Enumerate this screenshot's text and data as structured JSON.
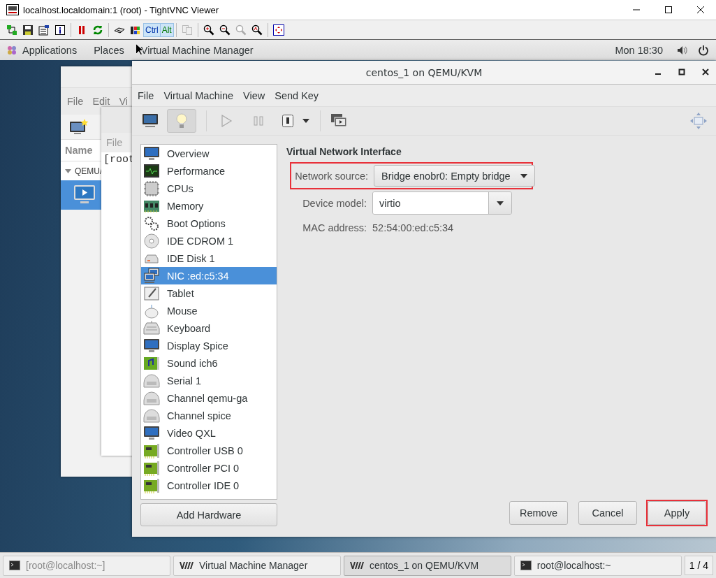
{
  "vnc_window": {
    "title": "localhost.localdomain:1 (root) - TightVNC Viewer",
    "ctrl": "Ctrl",
    "alt": "Alt"
  },
  "top_bar": {
    "applications": "Applications",
    "places": "Places",
    "app_menu": "Virtual Machine Manager",
    "clock": "Mon 18:30"
  },
  "manager_window": {
    "menu": [
      "File",
      "Edit",
      "Vi"
    ],
    "column": "Name",
    "group": "QEMU/"
  },
  "terminal_window": {
    "menu": "File",
    "line": "[root"
  },
  "main_window": {
    "title": "centos_1 on QEMU/KVM",
    "menu": [
      "File",
      "Virtual Machine",
      "View",
      "Send Key"
    ],
    "views": [
      {
        "kind": "console",
        "selected": false
      },
      {
        "kind": "details",
        "selected": true
      }
    ],
    "run_controls": {
      "disabled": true
    },
    "hardware": [
      {
        "name": "Overview",
        "kind": "monitor",
        "selected": false
      },
      {
        "name": "Performance",
        "kind": "graph",
        "selected": false
      },
      {
        "name": "CPUs",
        "kind": "chip",
        "selected": false
      },
      {
        "name": "Memory",
        "kind": "ram",
        "selected": false
      },
      {
        "name": "Boot Options",
        "kind": "gears",
        "selected": false
      },
      {
        "name": "IDE CDROM 1",
        "kind": "disc",
        "selected": false
      },
      {
        "name": "IDE Disk 1",
        "kind": "disk",
        "selected": false
      },
      {
        "name": "NIC :ed:c5:34",
        "kind": "network",
        "selected": true
      },
      {
        "name": "Tablet",
        "kind": "tablet",
        "selected": false
      },
      {
        "name": "Mouse",
        "kind": "mouse",
        "selected": false
      },
      {
        "name": "Keyboard",
        "kind": "keyboard",
        "selected": false
      },
      {
        "name": "Display Spice",
        "kind": "monitor",
        "selected": false
      },
      {
        "name": "Sound ich6",
        "kind": "sound",
        "selected": false
      },
      {
        "name": "Serial 1",
        "kind": "serial",
        "selected": false
      },
      {
        "name": "Channel qemu-ga",
        "kind": "serial",
        "selected": false
      },
      {
        "name": "Channel spice",
        "kind": "serial",
        "selected": false
      },
      {
        "name": "Video QXL",
        "kind": "monitor",
        "selected": false
      },
      {
        "name": "Controller USB 0",
        "kind": "card",
        "selected": false
      },
      {
        "name": "Controller PCI 0",
        "kind": "card",
        "selected": false
      },
      {
        "name": "Controller IDE 0",
        "kind": "card",
        "selected": false
      }
    ],
    "add_hardware": "Add Hardware",
    "section_title": "Virtual Network Interface",
    "network_source": {
      "label": "Network source:",
      "value": "Bridge enobr0: Empty bridge",
      "highlighted": true
    },
    "device_model": {
      "label": "Device model:",
      "value": "virtio"
    },
    "mac_address": {
      "label": "MAC address:",
      "value": "52:54:00:ed:c5:34"
    },
    "buttons": [
      {
        "label": "Remove",
        "highlighted": false
      },
      {
        "label": "Cancel",
        "highlighted": false
      },
      {
        "label": "Apply",
        "highlighted": true
      }
    ]
  },
  "taskbar": {
    "items": [
      {
        "label": "[root@localhost:~]",
        "kind": "terminal",
        "minimized": true,
        "selected": false
      },
      {
        "label": "Virtual Machine Manager",
        "kind": "vmm",
        "minimized": false,
        "selected": false
      },
      {
        "label": "centos_1 on QEMU/KVM",
        "kind": "vmm",
        "minimized": false,
        "selected": true
      },
      {
        "label": "root@localhost:~",
        "kind": "terminal",
        "minimized": false,
        "selected": false
      }
    ],
    "pager": "1 / 4"
  }
}
